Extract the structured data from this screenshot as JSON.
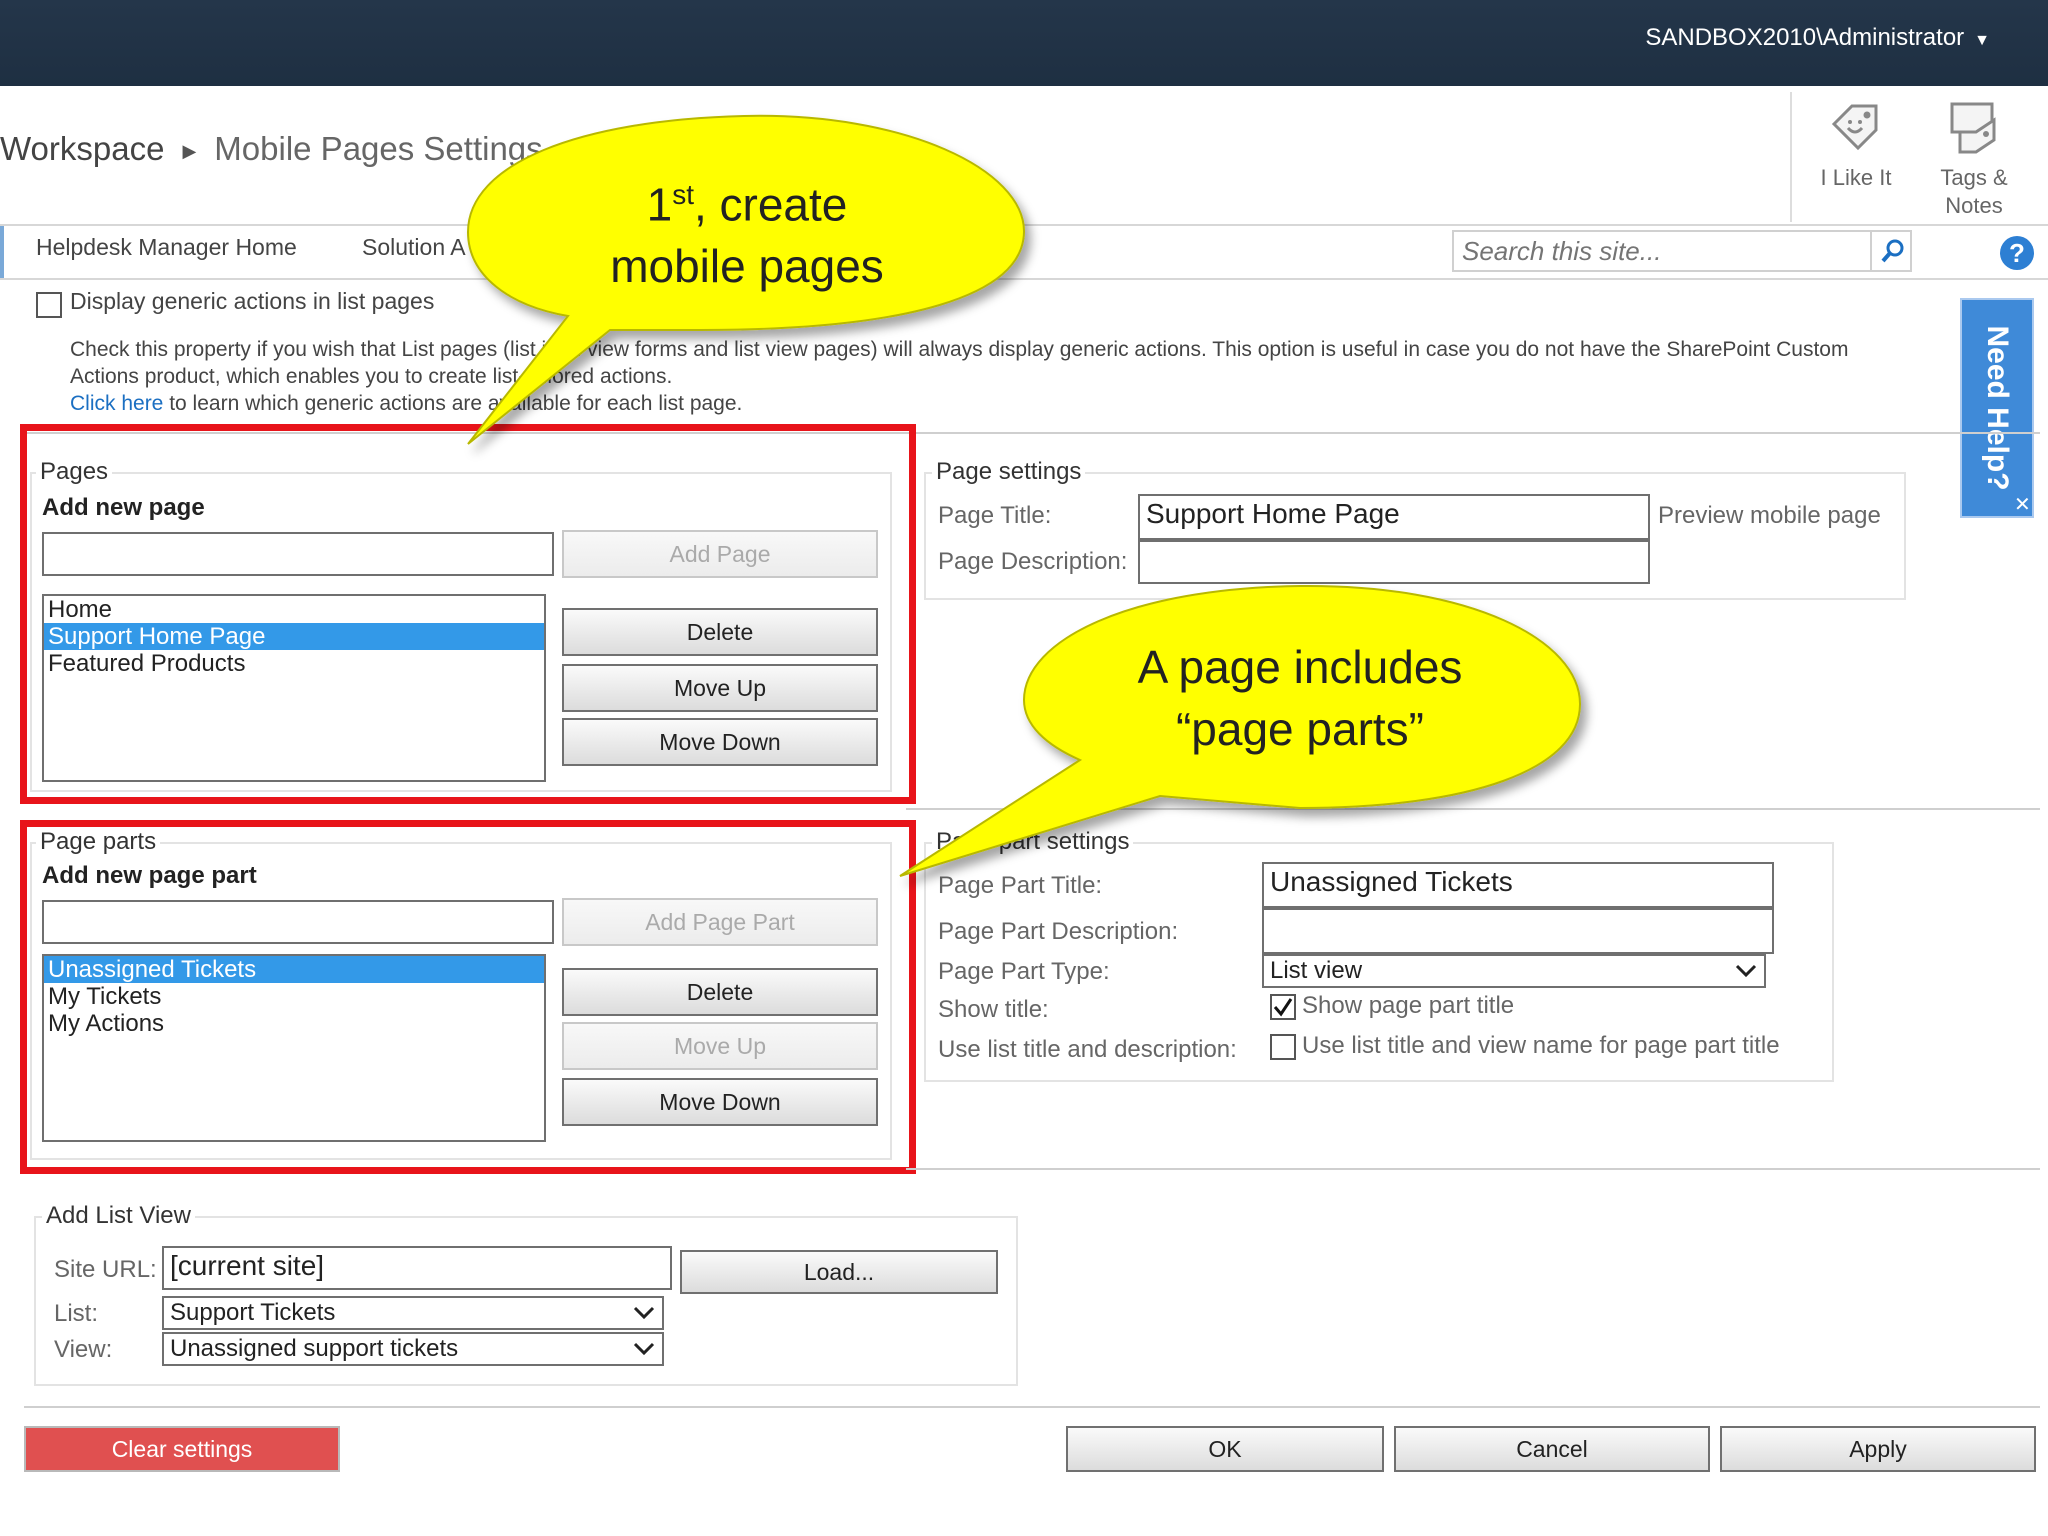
{
  "header": {
    "user": "SANDBOX2010\\Administrator",
    "breadcrumb": [
      "Workspace",
      "Mobile Pages Settings"
    ]
  },
  "tools": {
    "like_label_1": "I Like It",
    "tags_label_1": "Tags &",
    "tags_label_2": "Notes"
  },
  "nav": {
    "items": [
      "Helpdesk Manager Home",
      "Solution A"
    ],
    "search_placeholder": "Search this site...",
    "help_icon": "?"
  },
  "need_help": {
    "label": "Need Help?",
    "close": "✕"
  },
  "generic_actions": {
    "checkbox_label": "Display generic actions in list pages",
    "desc_line1": "Check this property if you wish that List pages (list item view forms and list view pages) will always display generic actions. This option is useful in case you do not have the SharePoint Custom",
    "desc_line2": "Actions product, which enables you to create list-tailored actions.",
    "link": "Click here",
    "desc_line3": " to learn which generic actions are available for each list page."
  },
  "pages": {
    "legend": "Pages",
    "add_title": "Add new page",
    "add_value": "",
    "add_button": "Add Page",
    "items": [
      "Home",
      "Support Home Page",
      "Featured Products"
    ],
    "selected_index": 1,
    "delete": "Delete",
    "move_up": "Move Up",
    "move_down": "Move Down"
  },
  "page_settings": {
    "legend": "Page settings",
    "title_label": "Page Title:",
    "title_value": "Support Home Page",
    "desc_label": "Page Description:",
    "desc_value": "",
    "preview": "Preview mobile page"
  },
  "page_parts": {
    "legend": "Page parts",
    "add_title": "Add new page part",
    "add_value": "",
    "add_button": "Add Page Part",
    "items": [
      "Unassigned Tickets",
      "My Tickets",
      "My Actions"
    ],
    "selected_index": 0,
    "delete": "Delete",
    "move_up": "Move Up",
    "move_down": "Move Down"
  },
  "page_part_settings": {
    "legend": "Page part settings",
    "title_label": "Page Part Title:",
    "title_value": "Unassigned Tickets",
    "desc_label": "Page Part Description:",
    "desc_value": "",
    "type_label": "Page Part Type:",
    "type_value": "List view",
    "show_title_label": "Show title:",
    "show_title_text": "Show page part title",
    "show_title_checked": true,
    "use_list_label": "Use list title and description:",
    "use_list_text": "Use list title and view name for page part title",
    "use_list_checked": false
  },
  "add_list_view": {
    "legend": "Add List View",
    "site_url_label": "Site URL:",
    "site_url_value": "[current site]",
    "load_button": "Load...",
    "list_label": "List:",
    "list_value": "Support Tickets",
    "view_label": "View:",
    "view_value": "Unassigned support tickets"
  },
  "footer": {
    "clear": "Clear settings",
    "ok": "OK",
    "cancel": "Cancel",
    "apply": "Apply"
  },
  "callouts": {
    "first_prefix": "1",
    "first_sup": "st",
    "first_rest": ", create",
    "first_line2": "mobile pages",
    "second_line1": "A page includes",
    "second_line2": "“page parts”"
  },
  "colors": {
    "topbar": "#1e2f42",
    "callout": "#ffff00",
    "highlight_border": "#e8141a",
    "selection": "#3399e8",
    "clear_button": "#e05050",
    "need_help": "#3f8ad8"
  }
}
